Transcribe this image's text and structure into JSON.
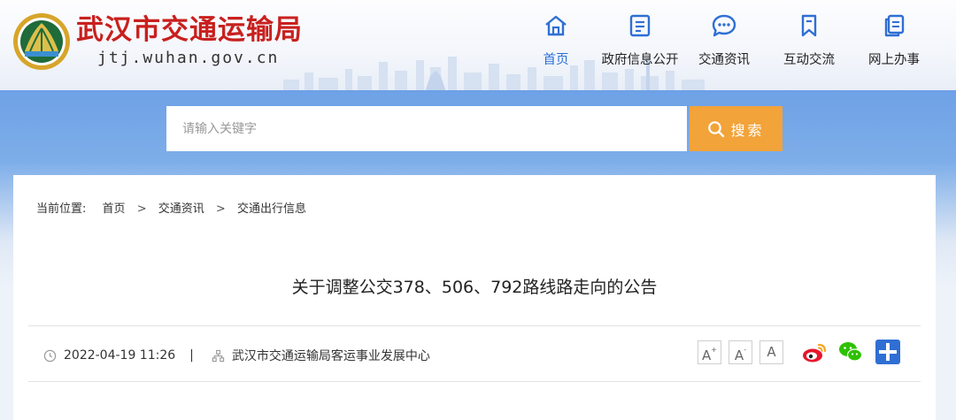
{
  "header": {
    "title": "武汉市交通运输局",
    "domain": "jtj.wuhan.gov.cn"
  },
  "nav": [
    {
      "label": "首页",
      "icon": "home-icon",
      "active": true
    },
    {
      "label": "政府信息公开",
      "icon": "document-icon"
    },
    {
      "label": "交通资讯",
      "icon": "chat-bubble-icon"
    },
    {
      "label": "互动交流",
      "icon": "bookmark-icon"
    },
    {
      "label": "网上办事",
      "icon": "copy-documents-icon"
    }
  ],
  "search": {
    "placeholder": "请输入关键字",
    "button_label": "搜索"
  },
  "breadcrumb": {
    "lead": "当前位置:",
    "items": [
      "首页",
      "交通资讯",
      "交通出行信息"
    ],
    "separator": ">"
  },
  "article": {
    "title": "关于调整公交378、506、792路线路走向的公告",
    "date": "2022-04-19 11:26",
    "divider": "|",
    "source": "武汉市交通运输局客运事业发展中心"
  },
  "font_controls": {
    "large": "A",
    "medium": "A",
    "small": "A"
  },
  "share": [
    "weibo-icon",
    "wechat-icon",
    "plus-share-icon"
  ],
  "colors": {
    "brand_red": "#c8201e",
    "active_blue": "#2a6fd6",
    "search_orange": "#f2a33a",
    "icon_blue": "#2f6fd3"
  }
}
